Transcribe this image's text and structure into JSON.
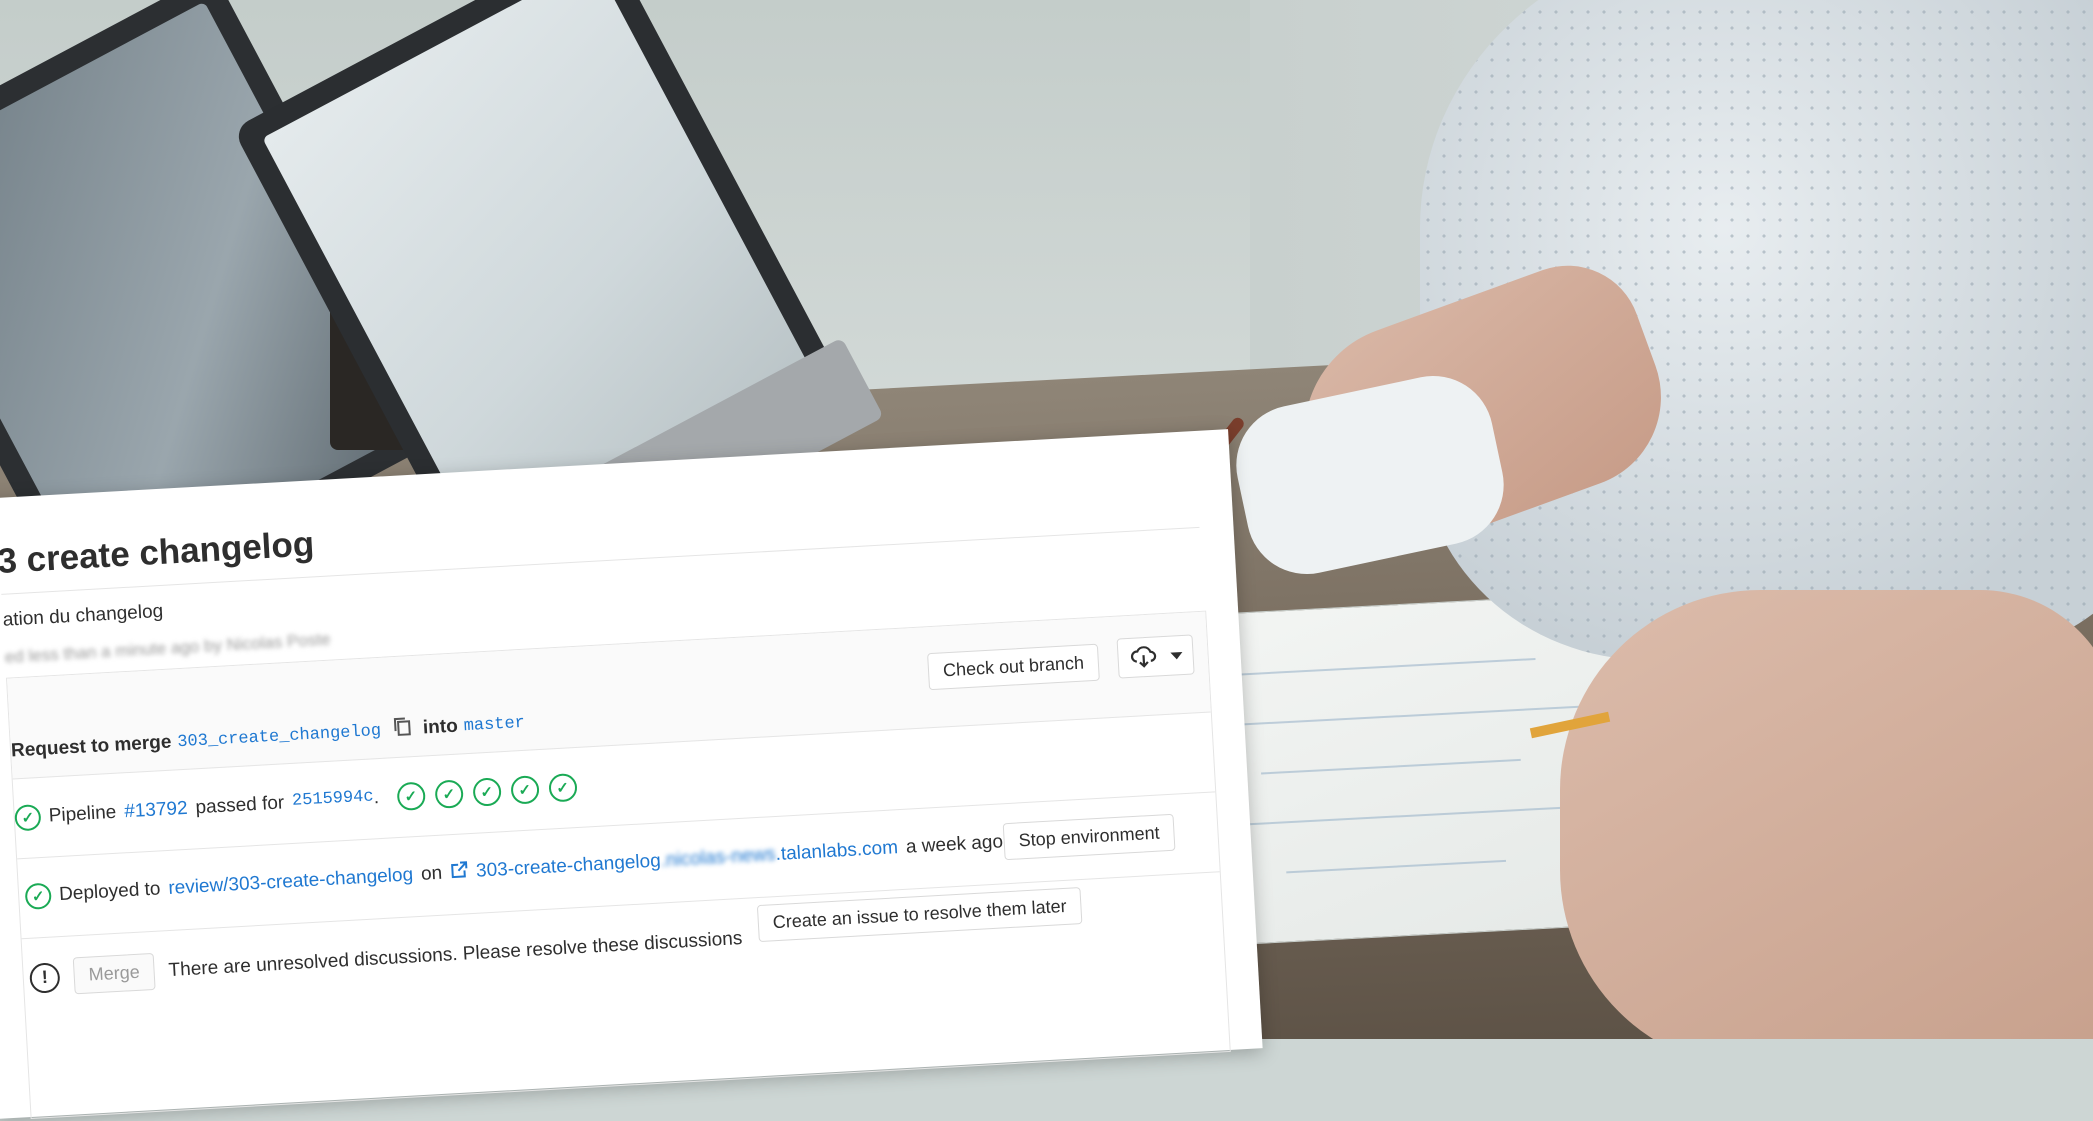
{
  "merge_request": {
    "title": "3 create changelog",
    "description": "ation du changelog",
    "blurred_meta": "ed less than a minute ago by Nicolas Poste",
    "checkout_label": "Check out branch",
    "request_to_merge_label": "Request to merge",
    "source_branch": "303_create_changelog",
    "into_label": "into",
    "target_branch": "master"
  },
  "pipeline": {
    "label": "Pipeline",
    "id": "#13792",
    "passed_for_label": "passed for",
    "commit": "2515994c",
    "period": ".",
    "stages_passed": 5
  },
  "deployment": {
    "prefix": "Deployed to",
    "environment": "review/303-create-changelog",
    "on_label": "on",
    "url_visible": "303-create-changelog",
    "url_blurred": ".nicolas-news",
    "url_domain": ".talanlabs.com",
    "time_ago": "a week ago",
    "stop_button": "Stop environment"
  },
  "discussions": {
    "merge_button": "Merge",
    "message": "There are unresolved discussions. Please resolve these discussions",
    "create_issue_button": "Create an issue to resolve them later"
  },
  "colors": {
    "link": "#1f78d1",
    "success": "#1aaa55"
  }
}
